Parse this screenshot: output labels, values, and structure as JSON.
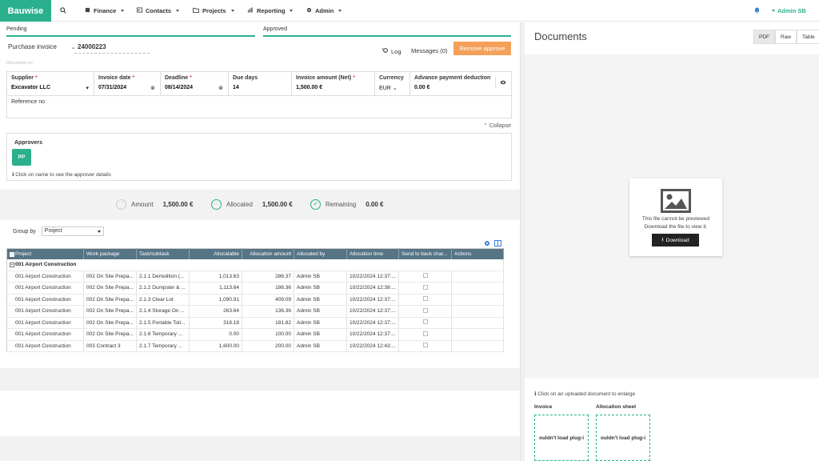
{
  "app": {
    "brand": "Bauwise"
  },
  "nav": {
    "items": [
      {
        "label": "Finance"
      },
      {
        "label": "Contacts"
      },
      {
        "label": "Projects"
      },
      {
        "label": "Reporting"
      },
      {
        "label": "Admin"
      }
    ],
    "user": "Admin SB"
  },
  "status": {
    "pending": "Pending",
    "approved": "Approved"
  },
  "header": {
    "doc_type": "Purchase invoice",
    "invoice_number": "24000223",
    "document_on": "Document on",
    "log": "Log",
    "messages": "Messages (0)",
    "remove_approve": "Remove approve"
  },
  "form": {
    "supplier_label": "Supplier",
    "supplier_value": "Excavator LLC",
    "invoice_date_label": "Invoice date",
    "invoice_date_value": "07/31/2024",
    "deadline_label": "Deadline",
    "deadline_value": "08/14/2024",
    "due_days_label": "Due days",
    "due_days_value": "14",
    "amount_label": "Invoice amount (Net)",
    "amount_value": "1,500.00 €",
    "currency_label": "Currency",
    "currency_value": "EUR",
    "advance_label": "Advance payment deduction",
    "advance_value": "0.00 €",
    "reference_label": "Reference no",
    "required_mark": "*",
    "collapse": "Collapse"
  },
  "approvers": {
    "title": "Approvers",
    "badge": "PP",
    "hint": "Click on name to see the approver details"
  },
  "summary": {
    "amount_label": "Amount",
    "amount_value": "1,500.00 €",
    "allocated_label": "Allocated",
    "allocated_value": "1,500.00 €",
    "remaining_label": "Remaining",
    "remaining_value": "0.00 €"
  },
  "allocation": {
    "group_by_label": "Group by",
    "group_by_value": "Project",
    "columns": [
      "Project",
      "Work package",
      "Task/subtask",
      "Allocatable",
      "Allocation amount",
      "Allocated by",
      "Allocation time",
      "Send to back char...",
      "Actions"
    ],
    "group_title": "001 Airport Construction",
    "rows": [
      {
        "project": "001 Airport Construction",
        "wp": "002 On Site Prepa...",
        "task": "2.1.1 Demolition (...",
        "allocatable": "1,013.63",
        "amount": "286.37",
        "by": "Admin SB",
        "time": "10/22/2024 12:37:..."
      },
      {
        "project": "001 Airport Construction",
        "wp": "002 On Site Prepa...",
        "task": "2.1.2 Dumpster & ...",
        "allocatable": "1,113.64",
        "amount": "186.36",
        "by": "Admin SB",
        "time": "10/22/2024 12:38:..."
      },
      {
        "project": "001 Airport Construction",
        "wp": "002 On Site Prepa...",
        "task": "2.1.3 Clear Lot",
        "allocatable": "1,090.91",
        "amount": "409.09",
        "by": "Admin SB",
        "time": "10/22/2024 12:37:..."
      },
      {
        "project": "001 Airport Construction",
        "wp": "002 On Site Prepa...",
        "task": "2.1.4 Storage On ...",
        "allocatable": "263.64",
        "amount": "136.36",
        "by": "Admin SB",
        "time": "10/22/2024 12:37:..."
      },
      {
        "project": "001 Airport Construction",
        "wp": "002 On Site Prepa...",
        "task": "2.1.5 Portable Toil...",
        "allocatable": "318.18",
        "amount": "181.82",
        "by": "Admin SB",
        "time": "10/22/2024 12:37:..."
      },
      {
        "project": "001 Airport Construction",
        "wp": "002 On Site Prepa...",
        "task": "2.1.6 Temporary ...",
        "allocatable": "0.00",
        "amount": "100.00",
        "by": "Admin SB",
        "time": "10/22/2024 12:37:..."
      },
      {
        "project": "001 Airport Construction",
        "wp": "003 Contract 3",
        "task": "2.1.7 Temporary ...",
        "allocatable": "1,600.00",
        "amount": "200.00",
        "by": "Admin SB",
        "time": "10/22/2024 12:43:..."
      }
    ]
  },
  "documents": {
    "title": "Documents",
    "views": [
      "PDF",
      "Raw",
      "Table"
    ],
    "preview_line1": "This file cannot be previewed",
    "preview_line2": "Download the file to view it.",
    "download": "Download",
    "thumb_hint": "Click on an uploaded document to enlarge",
    "thumb1_label": "Invoice",
    "thumb2_label": "Allocation sheet",
    "thumb_text": "ouldn't load plug-i"
  },
  "colors": {
    "accent": "#2bb08e",
    "orange": "#f5a05a",
    "grid_header": "#577485"
  }
}
